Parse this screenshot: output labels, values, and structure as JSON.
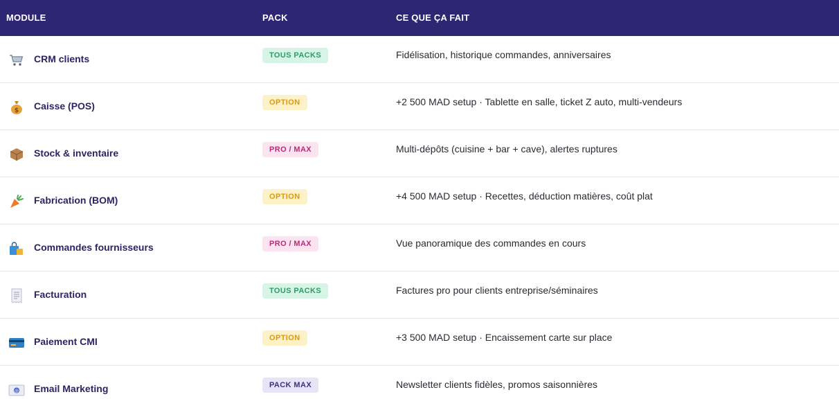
{
  "header": {
    "module": "MODULE",
    "pack": "PACK",
    "desc": "CE QUE ÇA FAIT"
  },
  "colors": {
    "header_bg": "#2d2673",
    "module_text": "#2b2466",
    "green_badge_bg": "#d7f5e6",
    "green_badge_text": "#2f9a6a",
    "yellow_badge_bg": "#fdf1c7",
    "yellow_badge_text": "#d89a16",
    "pink_badge_bg": "#fbe3f0",
    "pink_badge_text": "#b42d78",
    "purple_badge_bg": "#e7e4f8",
    "purple_badge_text": "#3c3279"
  },
  "rows": [
    {
      "icon": "shopping-cart-icon",
      "name": "CRM clients",
      "pack": "TOUS PACKS",
      "pack_style": "green",
      "desc": "Fidélisation, historique commandes, anniversaires"
    },
    {
      "icon": "money-bag-icon",
      "name": "Caisse (POS)",
      "pack": "OPTION",
      "pack_style": "yellow",
      "desc": "+2 500 MAD setup · Tablette en salle, ticket Z auto, multi-vendeurs"
    },
    {
      "icon": "package-box-icon",
      "name": "Stock & inventaire",
      "pack": "PRO / MAX",
      "pack_style": "pink",
      "desc": "Multi-dépôts (cuisine + bar + cave), alertes ruptures"
    },
    {
      "icon": "carrot-icon",
      "name": "Fabrication (BOM)",
      "pack": "OPTION",
      "pack_style": "yellow",
      "desc": "+4 500 MAD setup · Recettes, déduction matières, coût plat"
    },
    {
      "icon": "shopping-bags-icon",
      "name": "Commandes fournisseurs",
      "pack": "PRO / MAX",
      "pack_style": "pink",
      "desc": "Vue panoramique des commandes en cours"
    },
    {
      "icon": "receipt-icon",
      "name": "Facturation",
      "pack": "TOUS PACKS",
      "pack_style": "green",
      "desc": "Factures pro pour clients entreprise/séminaires"
    },
    {
      "icon": "credit-card-icon",
      "name": "Paiement CMI",
      "pack": "OPTION",
      "pack_style": "yellow",
      "desc": "+3 500 MAD setup · Encaissement carte sur place"
    },
    {
      "icon": "email-envelope-icon",
      "name": "Email Marketing",
      "pack": "PACK MAX",
      "pack_style": "purple",
      "desc": "Newsletter clients fidèles, promos saisonnières"
    }
  ]
}
